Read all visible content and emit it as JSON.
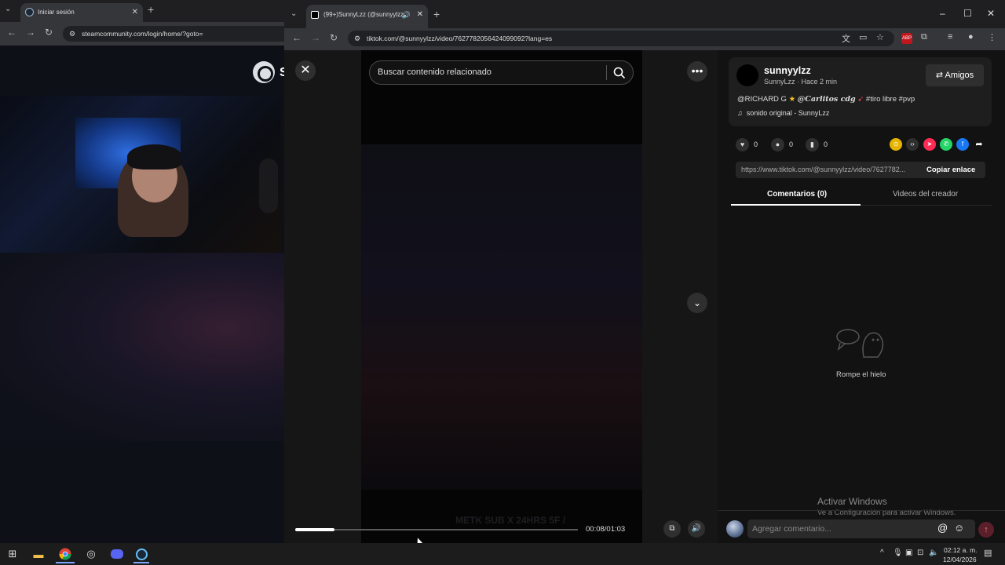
{
  "left_window": {
    "tab_title": "Iniciar sesión",
    "url": "steamcommunity.com/login/home/?goto=",
    "steam_letter": "S"
  },
  "right_window": {
    "tab_title": "(99+)SunnyLzz (@sunnyylzz",
    "url": "tiktok.com/@sunnyylzz/video/7627782056424099092?lang=es"
  },
  "video": {
    "search_placeholder": "Buscar contenido relacionado",
    "caption_overlay": "METK SUB X 24HRS 5F /",
    "time": "00:08/01:03",
    "progress": 0.14
  },
  "creator": {
    "name": "sunnyylzz",
    "subtitle": "SunnyLzz · Hace 2 min",
    "follow_label": "Amigos",
    "description_prefix": "@RICHARD G",
    "description_mention": "@Carlitos cdg",
    "description_tags": "#tiro libre #pvp",
    "sound": "sonido original - SunnyLzz"
  },
  "stats": {
    "likes": "0",
    "comments": "0",
    "saves": "0"
  },
  "link": {
    "url": "https://www.tiktok.com/@sunnyylzz/video/7627782...",
    "copy_label": "Copiar enlace"
  },
  "tabs": {
    "comments": "Comentarios (0)",
    "videos": "Videos del creador"
  },
  "empty_state": "Rompe el hielo",
  "comment_input": {
    "placeholder": "Agregar comentario..."
  },
  "watermark": {
    "title": "Activar Windows",
    "subtitle": "Ve a Configuración para activar Windows."
  },
  "clock": {
    "time": "02:12 a. m.",
    "date": "12/04/2026"
  },
  "colors": {
    "accent_red": "#fe2c55",
    "panel_bg": "#121212",
    "card_bg": "#1e1e1e"
  }
}
